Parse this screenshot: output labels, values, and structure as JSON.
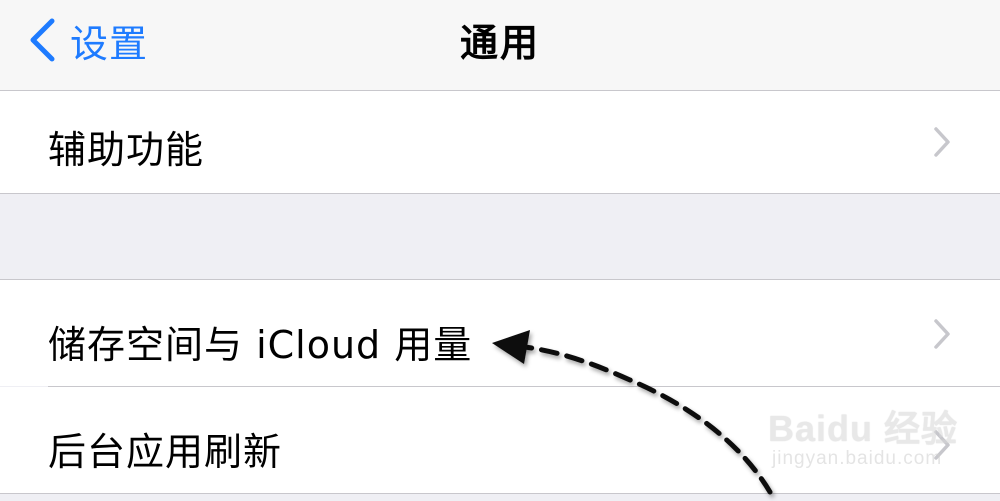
{
  "navbar": {
    "back_label": "设置",
    "title": "通用"
  },
  "cells": [
    {
      "label": "辅助功能"
    },
    {
      "label": "储存空间与 iCloud 用量"
    },
    {
      "label": "后台应用刷新"
    }
  ],
  "watermark": {
    "logo_text": "Baidu 经验",
    "url": "jingyan.baidu.com"
  },
  "colors": {
    "accent": "#1e7bff",
    "background": "#efeff4",
    "separator": "#c8c7cc",
    "chevron": "#c7c7cc"
  }
}
